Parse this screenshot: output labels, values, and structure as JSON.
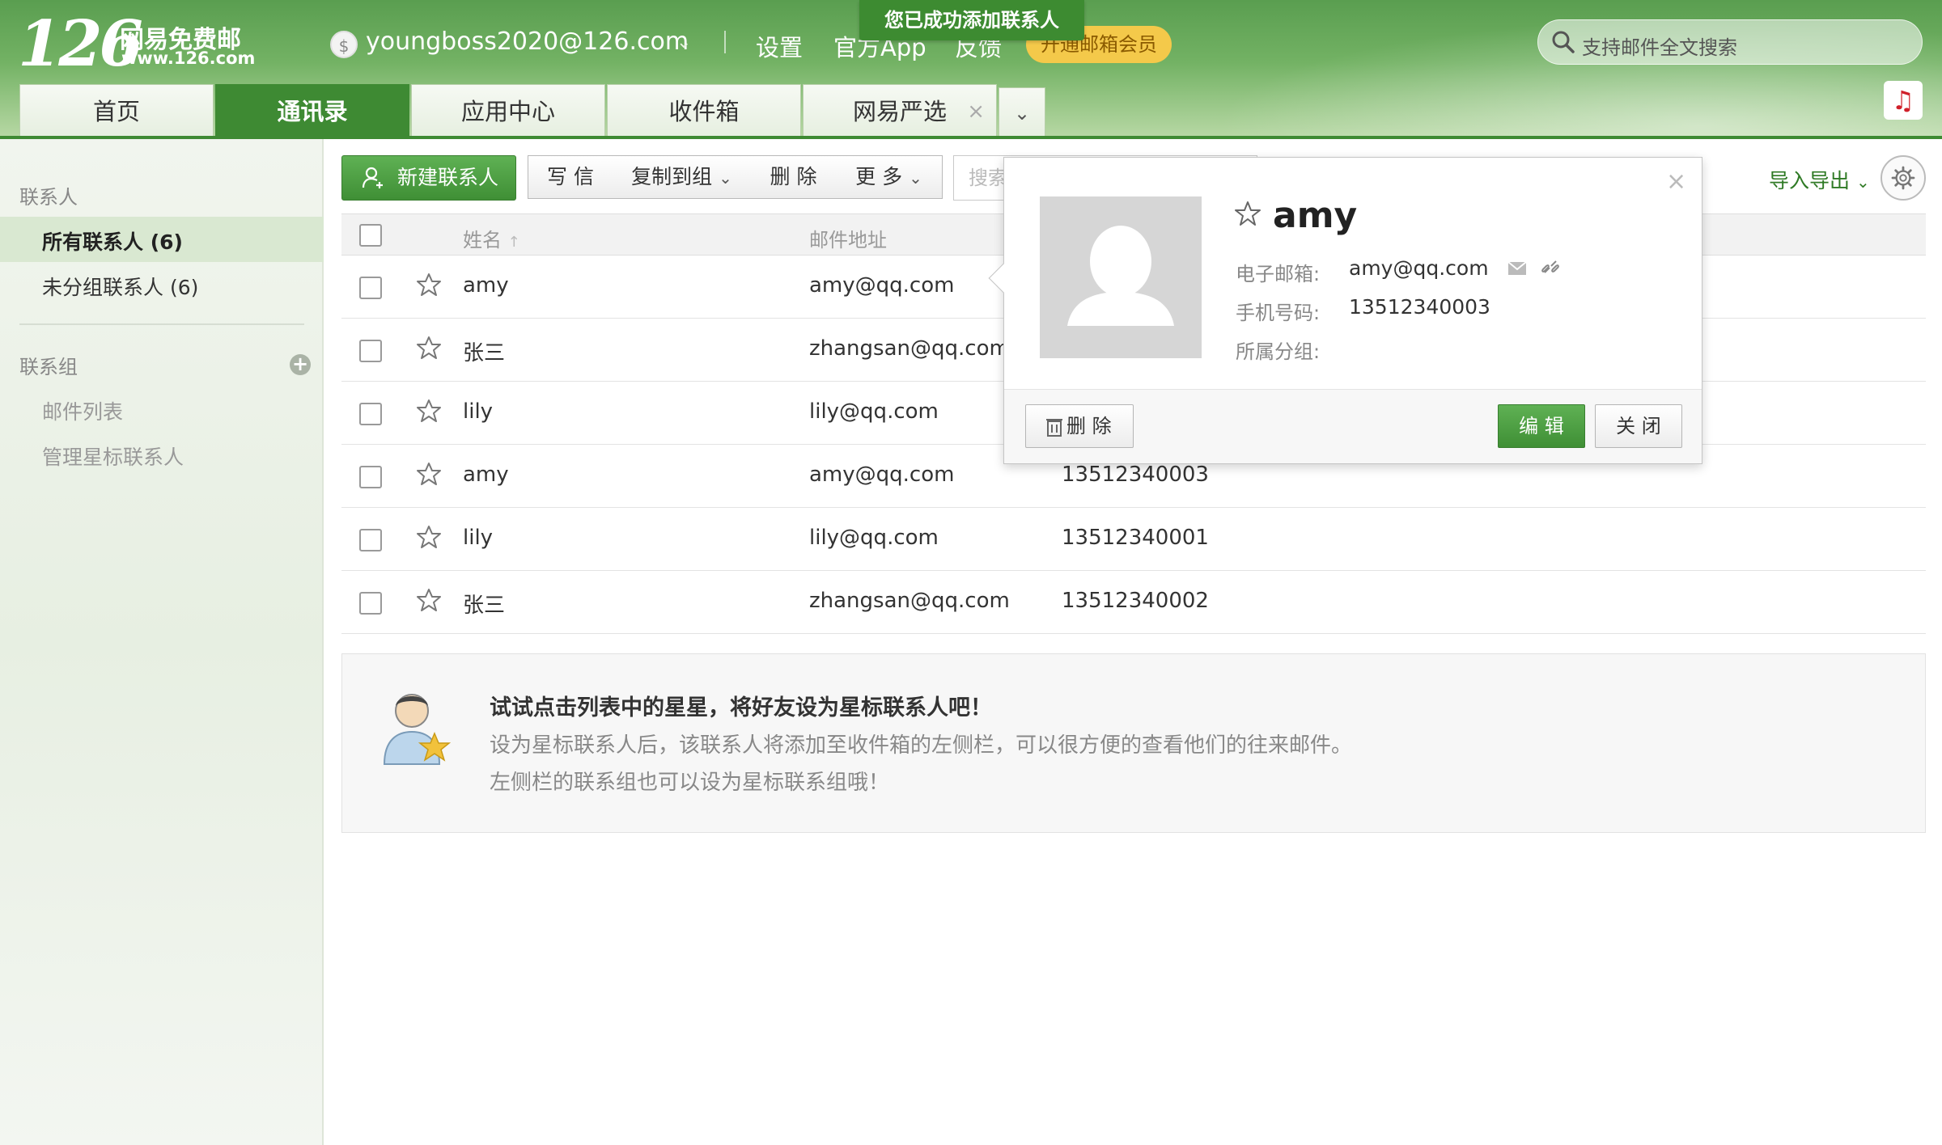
{
  "header": {
    "logo_number": "126",
    "logo_name": "网易免费邮",
    "logo_url": "www.126.com",
    "account_email": "youngboss2020@126.com",
    "links": [
      "设置",
      "官方App",
      "反馈"
    ],
    "vip_label": "开通邮箱会员",
    "toast": "您已成功添加联系人",
    "search_placeholder": "支持邮件全文搜索",
    "tabs": [
      {
        "label": "首页"
      },
      {
        "label": "通讯录"
      },
      {
        "label": "应用中心"
      },
      {
        "label": "收件箱"
      },
      {
        "label": "网易严选"
      }
    ],
    "tab_close": "×"
  },
  "sidebar": {
    "contacts_heading": "联系人",
    "all_contacts": "所有联系人 (6)",
    "ungrouped": "未分组联系人 (6)",
    "groups_heading": "联系组",
    "mail_list": "邮件列表",
    "manage_star": "管理星标联系人"
  },
  "toolbar": {
    "new_contact": "新建联系人",
    "write": "写 信",
    "copy_to_group": "复制到组",
    "delete": "删 除",
    "more": "更 多",
    "search_placeholder": "搜索",
    "import_export": "导入导出"
  },
  "table": {
    "col_name": "姓名",
    "col_email": "邮件地址",
    "rows": [
      {
        "name": "amy",
        "email": "amy@qq.com",
        "phone": ""
      },
      {
        "name": "张三",
        "email": "zhangsan@qq.com",
        "phone": ""
      },
      {
        "name": "lily",
        "email": "lily@qq.com",
        "phone": ""
      },
      {
        "name": "amy",
        "email": "amy@qq.com",
        "phone": "13512340003"
      },
      {
        "name": "lily",
        "email": "lily@qq.com",
        "phone": "13512340001"
      },
      {
        "name": "张三",
        "email": "zhangsan@qq.com",
        "phone": "13512340002"
      }
    ]
  },
  "tip": {
    "title": "试试点击列表中的星星，将好友设为星标联系人吧！",
    "line1": "设为星标联系人后，该联系人将添加至收件箱的左侧栏，可以很方便的查看他们的往来邮件。",
    "line2": "左侧栏的联系组也可以设为星标联系组哦！"
  },
  "popover": {
    "name": "amy",
    "email_label": "电子邮箱:",
    "email": "amy@qq.com",
    "phone_label": "手机号码:",
    "phone": "13512340003",
    "group_label": "所属分组:",
    "delete": "删 除",
    "edit": "编 辑",
    "close": "关 闭",
    "close_x": "×"
  },
  "colors": {
    "brand_green": "#3e8a33",
    "vip_yellow": "#f4c94a"
  }
}
